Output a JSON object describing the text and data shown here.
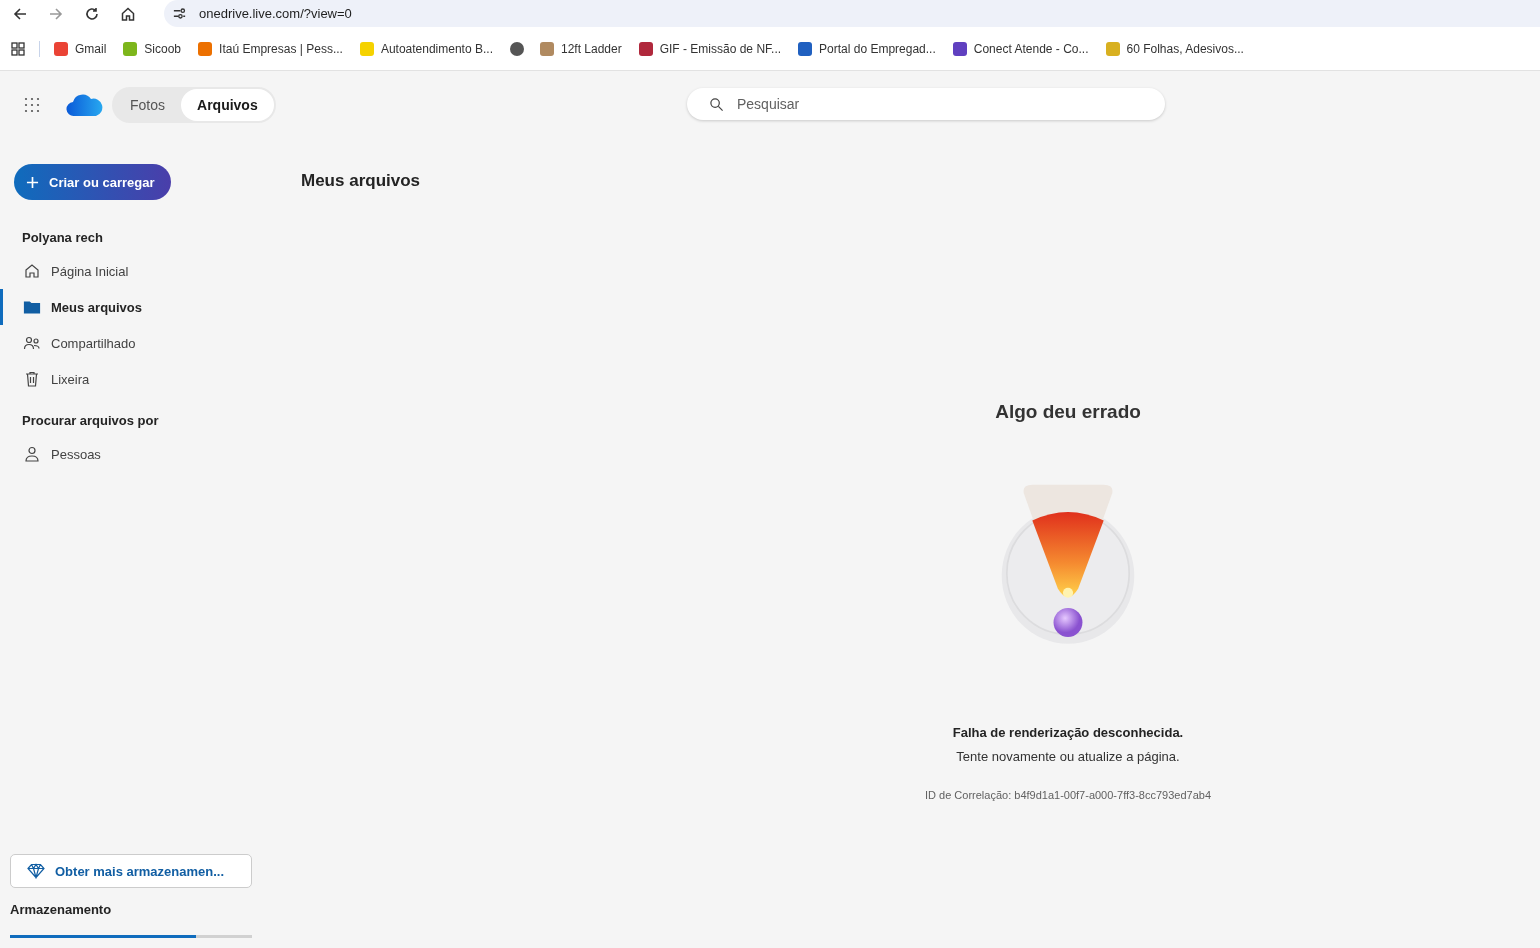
{
  "browser": {
    "url": "onedrive.live.com/?view=0",
    "bookmarks": [
      {
        "label": "Gmail",
        "color": "#ea4335"
      },
      {
        "label": "Sicoob",
        "color": "#7db61c"
      },
      {
        "label": "Itaú Empresas | Pess...",
        "color": "#ec7000"
      },
      {
        "label": "Autoatendimento B...",
        "color": "#f5d200"
      },
      {
        "color": "#555555"
      },
      {
        "label": "12ft Ladder",
        "color": "#b08a60"
      },
      {
        "label": "GIF - Emissão de NF...",
        "color": "#b0283c"
      },
      {
        "label": "Portal do Empregad...",
        "color": "#2060c0"
      },
      {
        "label": "Conect Atende - Co...",
        "color": "#6040c0"
      },
      {
        "label": "60 Folhas, Adesivos...",
        "color": "#d8b020"
      }
    ]
  },
  "header": {
    "tabs": [
      {
        "label": "Fotos",
        "selected": false
      },
      {
        "label": "Arquivos",
        "selected": true
      }
    ],
    "search": {
      "placeholder": "Pesquisar"
    }
  },
  "sidebar": {
    "create_button": "Criar ou carregar",
    "sections": [
      {
        "title": "Polyana rech",
        "items": [
          {
            "label": "Página Inicial",
            "kind": "home",
            "selected": false
          },
          {
            "label": "Meus arquivos",
            "kind": "folder",
            "selected": true
          },
          {
            "label": "Compartilhado",
            "kind": "shared",
            "selected": false
          },
          {
            "label": "Lixeira",
            "kind": "trash",
            "selected": false
          }
        ]
      },
      {
        "title": "Procurar arquivos por",
        "items": [
          {
            "label": "Pessoas",
            "kind": "person",
            "selected": false
          }
        ]
      }
    ],
    "storage_button": "Obter mais armazenamen...",
    "storage": {
      "title": "Armazenamento",
      "level": 0.77
    }
  },
  "main": {
    "title": "Meus arquivos",
    "error": {
      "title": "Algo deu errado",
      "message": "Falha de renderização desconhecida.",
      "hint": "Tente novamente ou atualize a página.",
      "correlation": "ID de Correlação: b4f9d1a1-00f7-a000-7ff3-8cc793ed7ab4"
    }
  }
}
